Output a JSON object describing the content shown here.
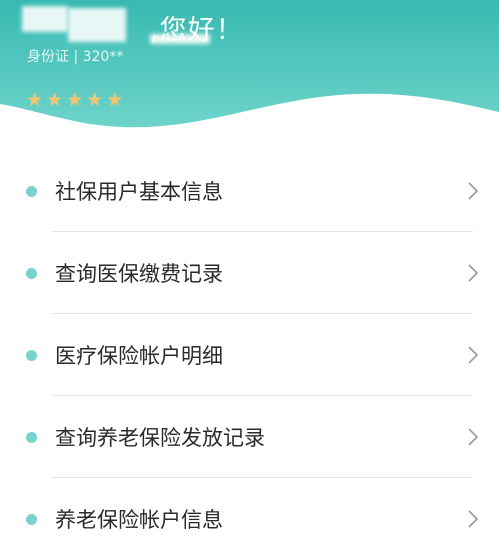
{
  "header": {
    "greeting": ",您好！",
    "id_line": "身份证 | 320**",
    "rating": 5,
    "colors": {
      "top": "#37b9b1",
      "bottom": "#6ed4cb",
      "star": "#f5c66e"
    }
  },
  "menu": {
    "dot_color": "#79d3cc",
    "items": [
      {
        "label": "社保用户基本信息",
        "icon": "chevron-right-icon"
      },
      {
        "label": "查询医保缴费记录",
        "icon": "chevron-right-icon"
      },
      {
        "label": "医疗保险帐户明细",
        "icon": "chevron-right-icon"
      },
      {
        "label": "查询养老保险发放记录",
        "icon": "chevron-right-icon"
      },
      {
        "label": "养老保险帐户信息",
        "icon": "chevron-right-icon"
      }
    ]
  }
}
